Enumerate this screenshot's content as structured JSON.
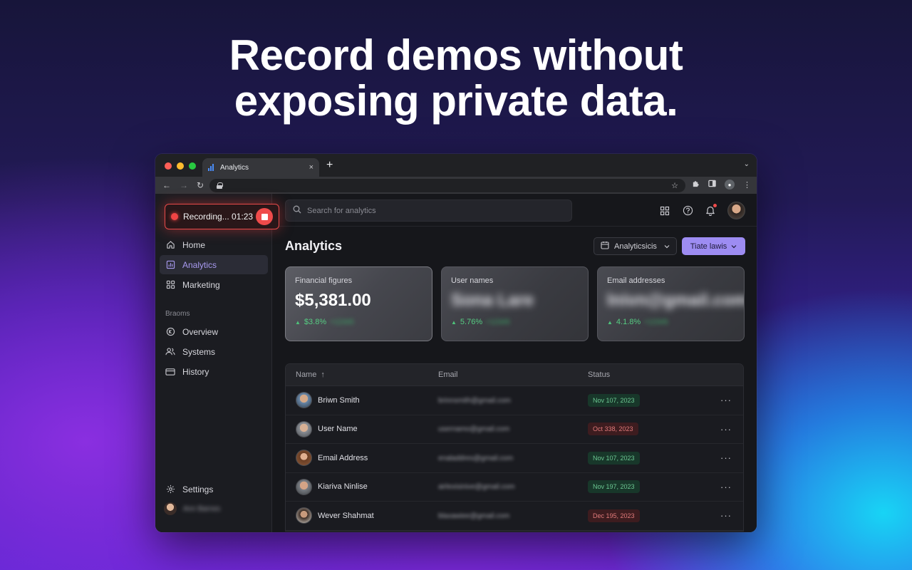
{
  "headline": {
    "line1": "Record demos without",
    "line2": "exposing private data."
  },
  "browser": {
    "tab_title": "Analytics",
    "new_tab": "+",
    "close": "×"
  },
  "recording": {
    "label": "Recording... 01:23"
  },
  "sidebar": {
    "items": [
      {
        "label": "Home",
        "icon": "home-icon"
      },
      {
        "label": "Analytics",
        "icon": "analytics-icon",
        "active": true
      },
      {
        "label": "Marketing",
        "icon": "grid-icon"
      }
    ],
    "section_label": "Braoms",
    "section_items": [
      {
        "label": "Overview",
        "icon": "overview-icon"
      },
      {
        "label": "Systems",
        "icon": "users-icon"
      },
      {
        "label": "History",
        "icon": "history-icon"
      }
    ],
    "settings_label": "Settings",
    "user_name": "Ann Barnes"
  },
  "search": {
    "placeholder": "Search for analytics"
  },
  "page": {
    "title": "Analytics",
    "dropdown_label": "Analyticsicis",
    "button_label": "Tiate lawis"
  },
  "cards": [
    {
      "label": "Financial figures",
      "value": "$5,381.00",
      "trend": "$3.8%",
      "trend_extra": "+12345"
    },
    {
      "label": "User names",
      "value": "Sona Lare",
      "trend": "5.76%",
      "trend_extra": "+12345"
    },
    {
      "label": "Email addresses",
      "value": "lnivn@gmail.com",
      "trend": "4.1.8%",
      "trend_extra": "+12345"
    }
  ],
  "table": {
    "headers": {
      "name": "Name",
      "email": "Email",
      "status": "Status",
      "sort": "↑"
    },
    "rows": [
      {
        "name": "Briwn Smith",
        "email": "brinnsmith@gmail.com",
        "status": "Nov 107, 2023",
        "status_color": "green"
      },
      {
        "name": "User Name",
        "email": "usernamo@gmail.com",
        "status": "Oct 338, 2023",
        "status_color": "red"
      },
      {
        "name": "Email Address",
        "email": "enaladdres@gmail.com",
        "status": "Nov 107, 2023",
        "status_color": "green"
      },
      {
        "name": "Kiariva Ninlise",
        "email": "airlexisinive@gmail.com",
        "status": "Nov 197, 2023",
        "status_color": "green"
      },
      {
        "name": "Wever Shahmat",
        "email": "blaxawiee@gmail.com",
        "status": "Dec 195, 2023",
        "status_color": "red"
      }
    ],
    "actions_label": "···"
  },
  "colors": {
    "accent": "#9d8cf2",
    "recording": "#ef4b4b",
    "positive": "#56cc82"
  }
}
